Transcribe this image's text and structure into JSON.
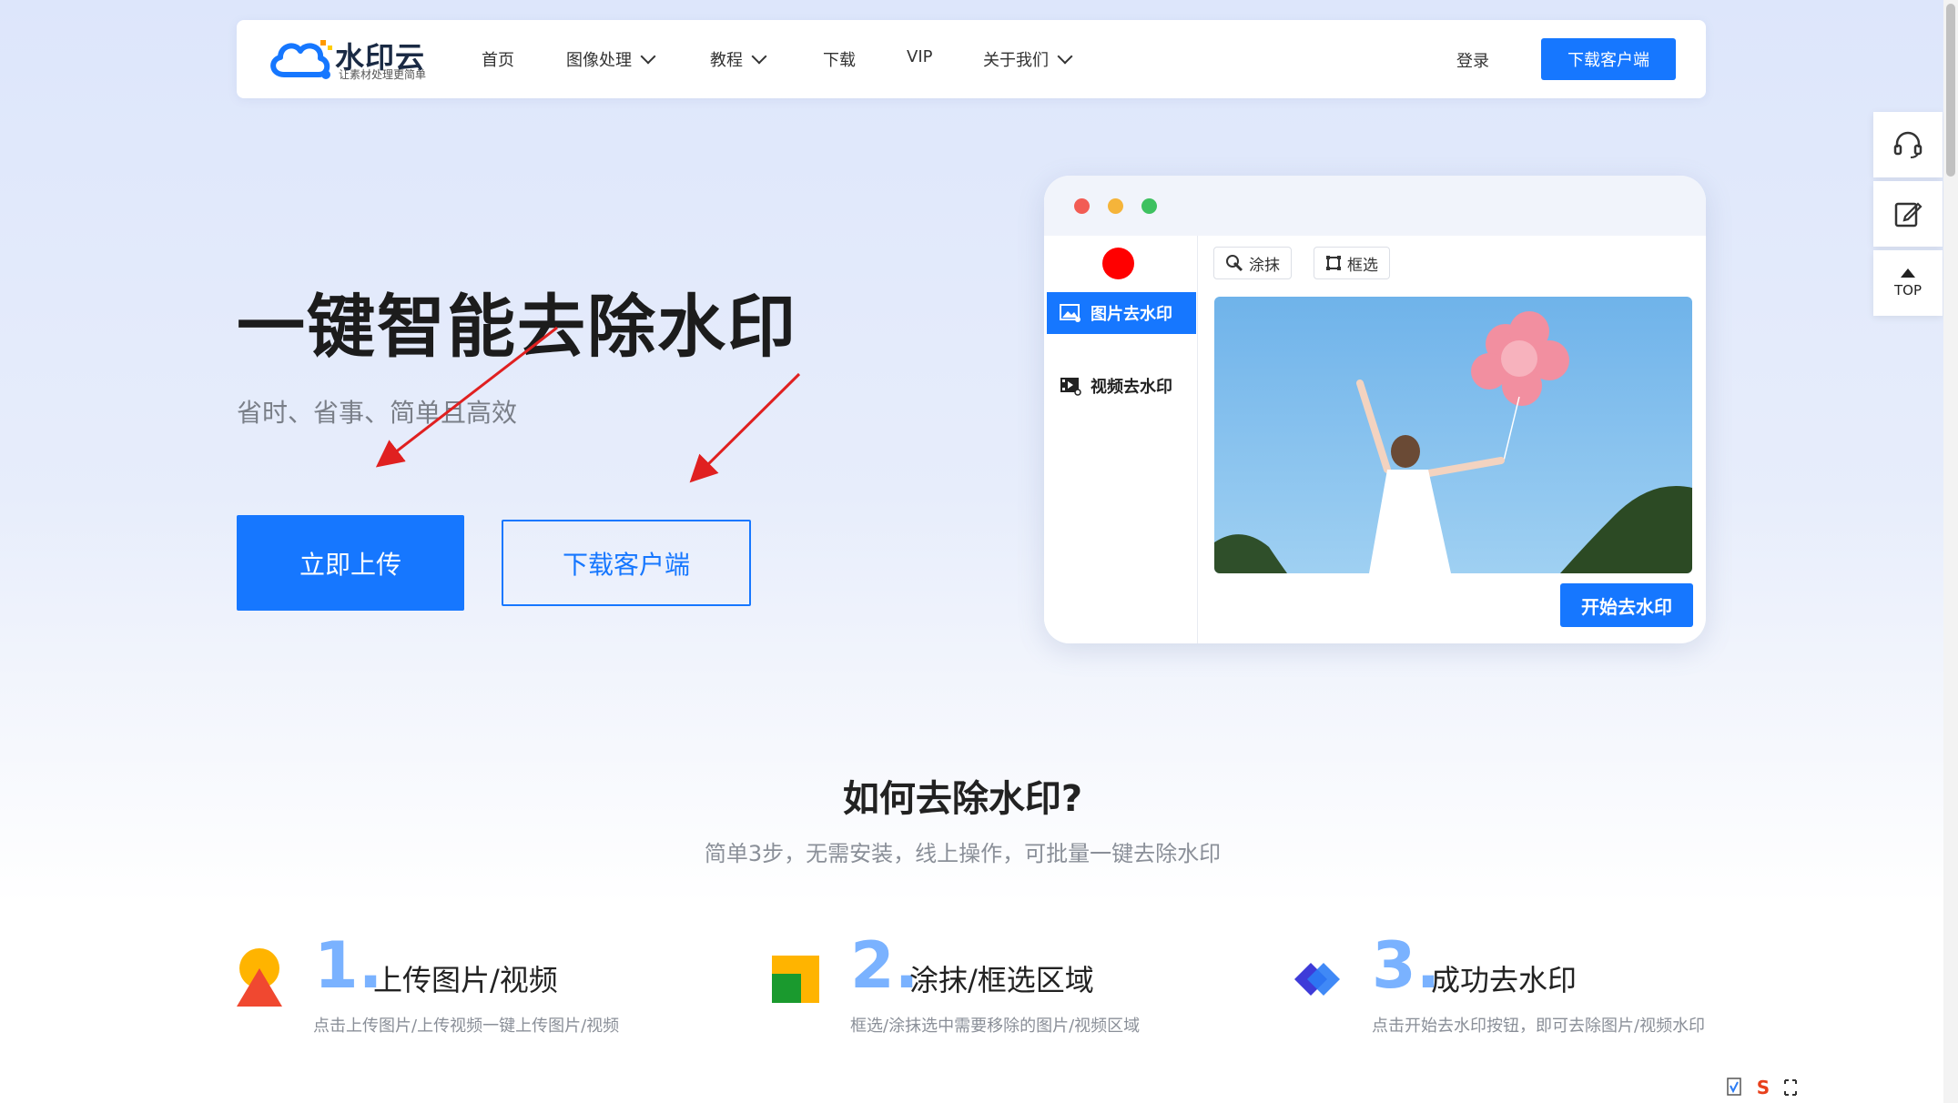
{
  "logo": {
    "title": "水印云",
    "subtitle": "让素材处理更简单"
  },
  "nav": {
    "items": [
      {
        "label": "首页"
      },
      {
        "label": "图像处理",
        "dropdown": true
      },
      {
        "label": "教程",
        "dropdown": true
      },
      {
        "label": "下载"
      },
      {
        "label": "VIP"
      },
      {
        "label": "关于我们",
        "dropdown": true
      }
    ],
    "login": "登录",
    "download_button": "下载客户端"
  },
  "hero": {
    "title": "一键智能去除水印",
    "subtitle": "省时、省事、简单且高效",
    "upload_button": "立即上传",
    "download_button": "下载客户端"
  },
  "mockup": {
    "sidebar": [
      "图片去水印",
      "视频去水印"
    ],
    "tools": [
      "涂抹",
      "框选"
    ],
    "start_button": "开始去水印"
  },
  "rail": {
    "top_label": "TOP"
  },
  "how": {
    "title": "如何去除水印?",
    "subtitle": "简单3步，无需安装，线上操作，可批量一键去除水印",
    "steps": [
      {
        "num": "1.",
        "title": "上传图片/视频",
        "desc": "点击上传图片/上传视频一键上传图片/视频"
      },
      {
        "num": "2.",
        "title": "涂抹/框选区域",
        "desc": "框选/涂抹选中需要移除的图片/视频区域"
      },
      {
        "num": "3.",
        "title": "成功去水印",
        "desc": "点击开始去水印按钮，即可去除图片/视频水印"
      }
    ]
  },
  "colors": {
    "primary": "#1677ff",
    "annotation": "#e02020"
  }
}
